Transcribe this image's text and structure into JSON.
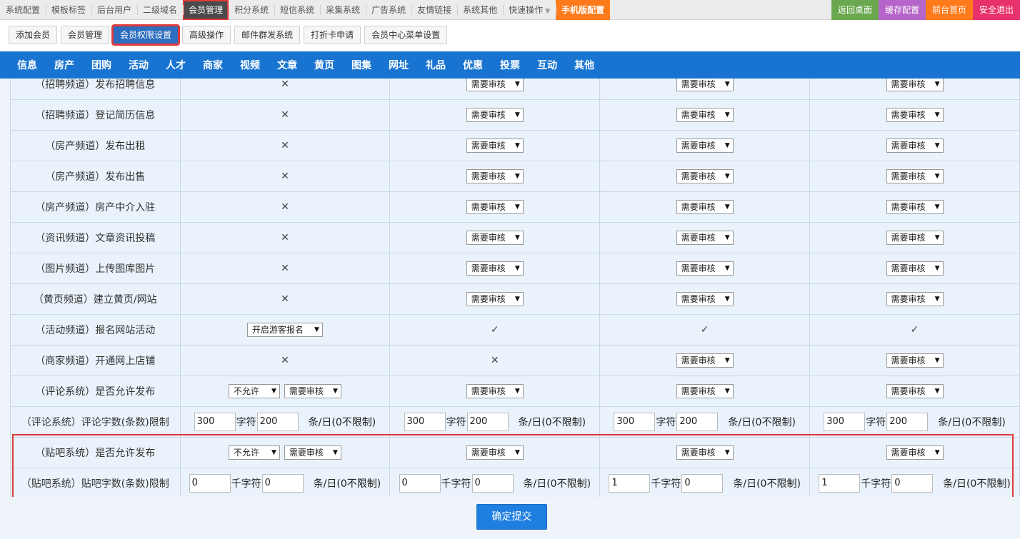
{
  "topnav": {
    "items": [
      "系统配置",
      "模板标签",
      "后台用户",
      "二级域名",
      "会员管理",
      "积分系统",
      "短信系统",
      "采集系统",
      "广告系统",
      "友情链接",
      "系统其他",
      "快速操作"
    ],
    "mobile": "手机版配置",
    "right": [
      {
        "label": "返回桌面",
        "color": "#6aa84f"
      },
      {
        "label": "缓存配置",
        "color": "#b565c9"
      },
      {
        "label": "前台首页",
        "color": "#ff7a1a"
      },
      {
        "label": "安全退出",
        "color": "#e8326b"
      }
    ]
  },
  "subbar": [
    "添加会员",
    "会员管理",
    "会员权限设置",
    "高级操作",
    "邮件群发系统",
    "打折卡申请",
    "会员中心菜单设置"
  ],
  "channels": [
    "信息",
    "房产",
    "团购",
    "活动",
    "人才",
    "商家",
    "视频",
    "文章",
    "黄页",
    "图集",
    "网址",
    "礼品",
    "优惠",
    "投票",
    "互动",
    "其他"
  ],
  "rows": [
    {
      "label": "（招聘频道）发布招聘信息",
      "cells": [
        "x",
        "需要审核",
        "需要审核",
        "需要审核"
      ]
    },
    {
      "label": "（招聘频道）登记简历信息",
      "cells": [
        "x",
        "需要审核",
        "需要审核",
        "需要审核"
      ]
    },
    {
      "label": "（房产频道）发布出租",
      "cells": [
        "x",
        "需要审核",
        "需要审核",
        "需要审核"
      ]
    },
    {
      "label": "（房产频道）发布出售",
      "cells": [
        "x",
        "需要审核",
        "需要审核",
        "需要审核"
      ]
    },
    {
      "label": "（房产频道）房产中介入驻",
      "cells": [
        "x",
        "需要审核",
        "需要审核",
        "需要审核"
      ]
    },
    {
      "label": "（资讯频道）文章资讯投稿",
      "cells": [
        "x",
        "需要审核",
        "需要审核",
        "需要审核"
      ]
    },
    {
      "label": "（图片频道）上传图库图片",
      "cells": [
        "x",
        "需要审核",
        "需要审核",
        "需要审核"
      ]
    },
    {
      "label": "（黄页频道）建立黄页/网站",
      "cells": [
        "x",
        "需要审核",
        "需要审核",
        "需要审核"
      ]
    },
    {
      "label": "（活动频道）报名网站活动",
      "cells": [
        "开启游客报名",
        "check",
        "check",
        "check"
      ]
    },
    {
      "label": "（商家频道）开通网上店铺",
      "cells": [
        "x",
        "x",
        "需要审核",
        "需要审核"
      ]
    },
    {
      "label": "（评论系统）是否允许发布",
      "cells": [
        "不允许|需要审核",
        "需要审核",
        "需要审核",
        "需要审核"
      ]
    }
  ],
  "comment_limit": {
    "label": "（评论系统）评论字数(条数)限制",
    "unit1": "字符",
    "unit2": "条/日(0不限制)",
    "values": [
      [
        "300",
        "200"
      ],
      [
        "300",
        "200"
      ],
      [
        "300",
        "200"
      ],
      [
        "300",
        "200"
      ]
    ]
  },
  "tieba_publish": {
    "label": "（贴吧系统）是否允许发布",
    "first": [
      "不允许",
      "需要审核"
    ],
    "others": [
      "需要审核",
      "需要审核",
      "需要审核"
    ]
  },
  "tieba_limit": {
    "label": "（贴吧系统）贴吧字数(条数)限制",
    "unit1": "千字符",
    "unit2": "条/日(0不限制)",
    "values": [
      [
        "0",
        "0"
      ],
      [
        "0",
        "0"
      ],
      [
        "1",
        "0"
      ],
      [
        "1",
        "0"
      ]
    ]
  },
  "marks": {
    "x": "✕",
    "check": "✓"
  },
  "submit": "确定提交"
}
